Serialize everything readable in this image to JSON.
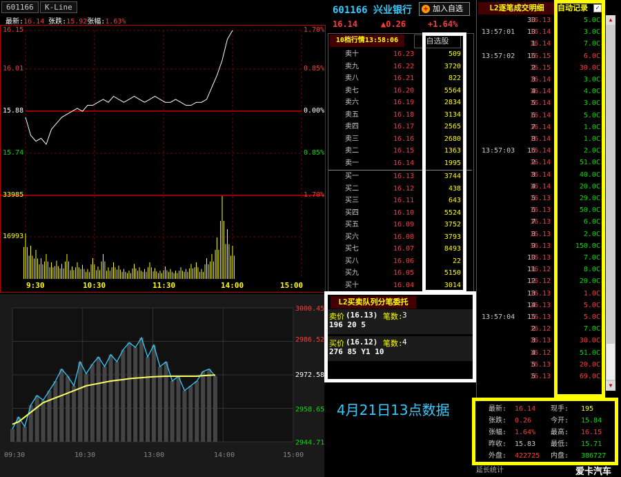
{
  "tabs": {
    "code": "601166",
    "kline": "K-Line"
  },
  "topbar": {
    "last_label": "最新:",
    "last": "16.14",
    "chg_label": "张跌:",
    "chg": "15.92",
    "pct_label": "张幅:",
    "pct": "1.63%"
  },
  "intraday": {
    "price_labels": [
      "16.15",
      "16.01",
      "15.88",
      "15.74"
    ],
    "pct_labels": [
      "1.70%",
      "0.85%",
      "0.00%",
      "0.85%"
    ],
    "vol_labels": [
      "33985",
      "16993"
    ],
    "vol_pct": "1.70%",
    "time_labels": [
      "9:30",
      "10:30",
      "11:30",
      "14:00",
      "15:00"
    ],
    "prices": [
      15.86,
      15.8,
      15.78,
      15.79,
      15.77,
      15.82,
      15.84,
      15.86,
      15.87,
      15.88,
      15.89,
      15.88,
      15.9,
      15.9,
      15.91,
      15.92,
      15.91,
      15.93,
      15.92,
      15.91,
      15.92,
      15.93,
      15.92,
      15.91,
      15.92,
      15.93,
      15.92,
      15.91,
      15.91,
      15.92,
      15.91,
      15.9,
      15.9,
      15.91,
      15.91,
      15.92,
      15.96,
      16.0,
      16.05,
      16.12,
      16.15
    ],
    "volumes": [
      0.55,
      0.4,
      0.35,
      0.25,
      0.3,
      0.2,
      0.22,
      0.18,
      0.3,
      0.15,
      0.2,
      0.17,
      0.12,
      0.25,
      0.15,
      0.3,
      0.14,
      0.2,
      0.16,
      0.12,
      0.1,
      0.18,
      0.14,
      0.12,
      0.2,
      0.13,
      0.1,
      0.15,
      0.12,
      0.1,
      0.14,
      0.12,
      0.18,
      0.2,
      0.12,
      0.25,
      0.3,
      0.5,
      1.0,
      0.6,
      0.4
    ]
  },
  "lower_chart": {
    "y_labels": [
      "3000.45",
      "2986.52",
      "2972.58",
      "2958.65",
      "2944.71"
    ],
    "x_labels": [
      "09:30",
      "10:30",
      "13:00",
      "14:00",
      "15:00"
    ],
    "index": [
      2950,
      2955,
      2951,
      2960,
      2964,
      2962,
      2966,
      2970,
      2975,
      2972,
      2968,
      2978,
      2973,
      2977,
      2980,
      2976,
      2981,
      2978,
      2983,
      2986,
      2984,
      2988,
      2980,
      2985,
      2976,
      2978,
      2970,
      2972,
      2966,
      2968,
      2970,
      2974,
      2975,
      2972
    ],
    "avg": [
      2952,
      2953,
      2955,
      2957,
      2959,
      2961,
      2962,
      2963,
      2964,
      2965,
      2966,
      2967,
      2968,
      2968.5,
      2969,
      2969.5,
      2970,
      2970.3,
      2970.6,
      2971,
      2971.2,
      2971.4,
      2971.6,
      2971.8,
      2971.9,
      2972,
      2972,
      2972,
      2972,
      2972,
      2972,
      2972.2,
      2972.4,
      2972.5
    ]
  },
  "stock": {
    "code": "601166",
    "name": "兴业银行",
    "add_label": "加入自选",
    "price": "16.14",
    "change": "▲0.26",
    "pct": "+1.64%"
  },
  "orderbook": {
    "tab1": "10档行情13:58:06",
    "tab2": "自选股",
    "asks": [
      [
        "卖十",
        "16.23",
        "509"
      ],
      [
        "卖九",
        "16.22",
        "3720"
      ],
      [
        "卖八",
        "16.21",
        "822"
      ],
      [
        "卖七",
        "16.20",
        "5564"
      ],
      [
        "卖六",
        "16.19",
        "2834"
      ],
      [
        "卖五",
        "16.18",
        "3134"
      ],
      [
        "卖四",
        "16.17",
        "2565"
      ],
      [
        "卖三",
        "16.16",
        "2680"
      ],
      [
        "卖二",
        "16.15",
        "1363"
      ],
      [
        "卖一",
        "16.14",
        "1995"
      ]
    ],
    "bids": [
      [
        "买一",
        "16.13",
        "3744"
      ],
      [
        "买二",
        "16.12",
        "438"
      ],
      [
        "买三",
        "16.11",
        "643"
      ],
      [
        "买四",
        "16.10",
        "5524"
      ],
      [
        "买五",
        "16.09",
        "3752"
      ],
      [
        "买六",
        "16.08",
        "3793"
      ],
      [
        "买七",
        "16.07",
        "8493"
      ],
      [
        "买八",
        "16.06",
        "22"
      ],
      [
        "买九",
        "16.05",
        "5150"
      ],
      [
        "买十",
        "16.04",
        "3014"
      ]
    ]
  },
  "queue": {
    "title": "L2买卖队列分笔委托",
    "sell_label": "卖价",
    "sell_price": "(16.13)",
    "sell_count_label": "笔数:",
    "sell_count": "3",
    "sell_orders": "196  20  5",
    "buy_label": "买价",
    "buy_price": "(16.12)",
    "buy_count_label": "笔数:",
    "buy_count": "4",
    "buy_orders": "276  85  Y1  10"
  },
  "ticks": {
    "title": "L2逐笔成交明细",
    "auto_label": "自动记录",
    "rows": [
      [
        "",
        "30",
        "16.13",
        "5.0C↓"
      ],
      [
        "13:57:01",
        "10",
        "16.14",
        "3.0C↓"
      ],
      [
        "",
        "1",
        "16.14",
        "7.0C↓"
      ],
      [
        "13:57:02",
        "16",
        "16.15",
        "6.0C↑"
      ],
      [
        "",
        "2",
        "16.15",
        "30.0C↑"
      ],
      [
        "",
        "3",
        "16.14",
        "3.0C↓"
      ],
      [
        "",
        "4",
        "16.14",
        "4.0C↓"
      ],
      [
        "",
        "5",
        "16.14",
        "3.0C↓"
      ],
      [
        "",
        "6",
        "16.14",
        "5.0C↓"
      ],
      [
        "",
        "7",
        "16.14",
        "1.0C↓"
      ],
      [
        "",
        "8",
        "16.14",
        "1.0C↓"
      ],
      [
        "13:57:03",
        "16",
        "16.14",
        "2.0C↓"
      ],
      [
        "",
        "2",
        "16.14",
        "51.0C↓"
      ],
      [
        "",
        "3",
        "16.14",
        "40.0C↓"
      ],
      [
        "",
        "4",
        "16.14",
        "20.0C↓"
      ],
      [
        "",
        "5",
        "16.13",
        "29.0C↓"
      ],
      [
        "",
        "6",
        "16.13",
        "50.0C↓"
      ],
      [
        "",
        "7",
        "16.13",
        "6.0C↓"
      ],
      [
        "",
        "8",
        "16.13",
        "2.0C↓"
      ],
      [
        "",
        "9",
        "16.13",
        "150.0C↓"
      ],
      [
        "",
        "10",
        "16.13",
        "7.0C↓"
      ],
      [
        "",
        "11",
        "16.12",
        "8.0C↓"
      ],
      [
        "",
        "12",
        "16.12",
        "20.0C↓"
      ],
      [
        "",
        "13",
        "16.13",
        "1.0C↑"
      ],
      [
        "",
        "14",
        "16.13",
        "5.0C↑"
      ],
      [
        "13:57:04",
        "15",
        "16.13",
        "5.0C↑"
      ],
      [
        "",
        "2",
        "16.12",
        "7.0C↓"
      ],
      [
        "",
        "3",
        "16.13",
        "30.0C↑"
      ],
      [
        "",
        "4",
        "16.12",
        "51.0C↓"
      ],
      [
        "",
        "5",
        "16.13",
        "20.0C↑"
      ],
      [
        "",
        "5",
        "16.13",
        "69.0C↑"
      ]
    ]
  },
  "summary": {
    "rows": [
      [
        "最新:",
        "16.14",
        "现手:",
        "195"
      ],
      [
        "张跌:",
        "0.26",
        "今开:",
        "15.84"
      ],
      [
        "张幅:",
        "1.64%",
        "最高:",
        "16.15"
      ],
      [
        "昨收:",
        "15.83",
        "最低:",
        "15.71"
      ],
      [
        "外盘:",
        "422725",
        "内盘:",
        "386727"
      ]
    ]
  },
  "caption": "4月21日13点数据",
  "footer": {
    "left": "延长统计",
    "right": "爱卡汽车"
  }
}
